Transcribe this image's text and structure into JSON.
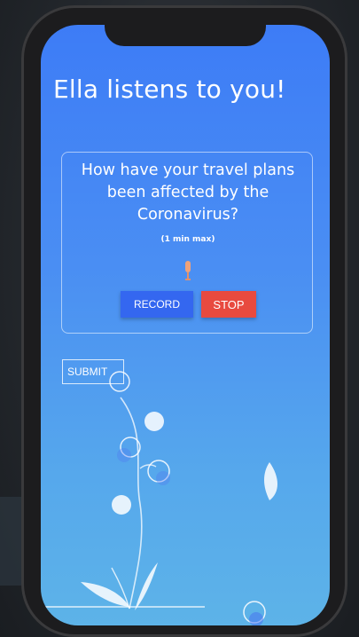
{
  "app": {
    "title": "Ella listens to you!"
  },
  "prompt_card": {
    "question": "How have your travel plans been affected by the Coronavirus?",
    "hint": "(1 min max)"
  },
  "controls": {
    "record_label": "RECORD",
    "stop_label": "STOP",
    "submit_label": "SUBMIT"
  },
  "icons": {
    "microphone": "microphone-icon"
  },
  "colors": {
    "record": "#3467f0",
    "stop": "#e84a3f"
  }
}
